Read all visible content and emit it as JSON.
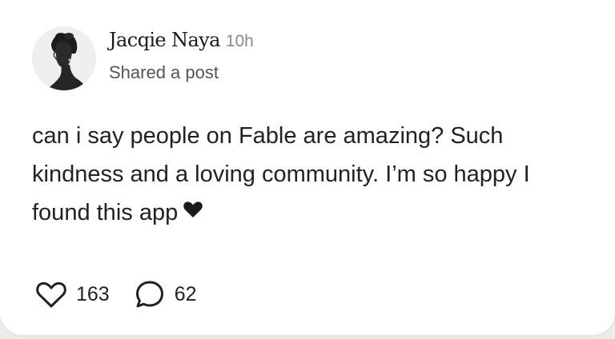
{
  "post": {
    "author_name": "Jacqie Naya",
    "time_ago": "10h",
    "subtitle": "Shared a post",
    "text": "can i say people on Fable are amazing? Such kindness and a loving community. I’m so happy I found this app",
    "text_trailing_icon": "black-heart-icon"
  },
  "actions": {
    "like_count": "163",
    "comment_count": "62",
    "like_icon": "heart-outline-icon",
    "comment_icon": "speech-bubble-icon"
  },
  "colors": {
    "text": "#222222",
    "muted": "#8a8a8a",
    "background": "#ffffff"
  }
}
